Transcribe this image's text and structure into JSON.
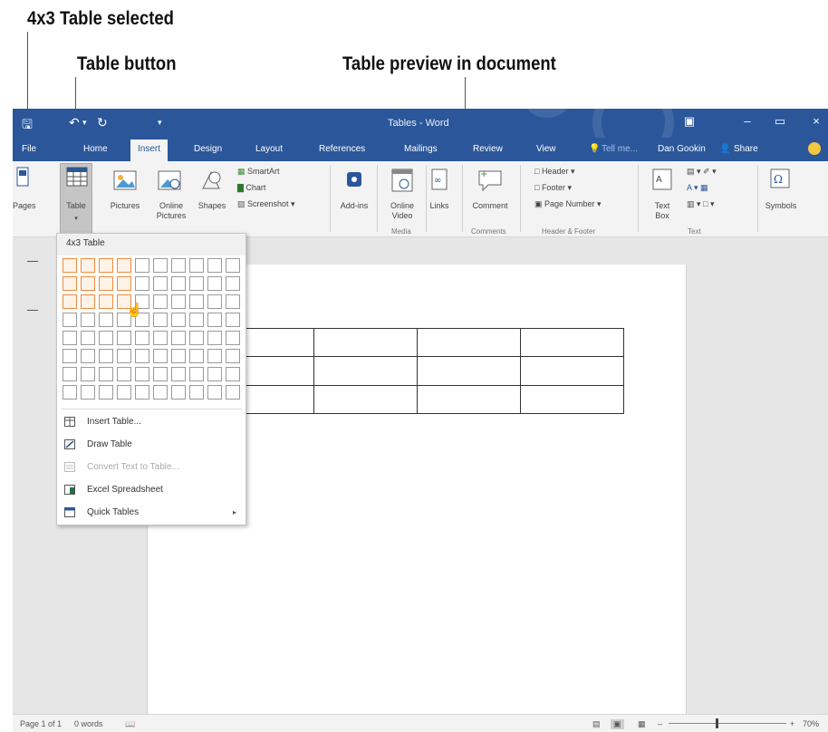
{
  "callouts": {
    "table_selected": "4x3 Table selected",
    "table_button": "Table button",
    "table_preview": "Table preview in document"
  },
  "title_bar": {
    "title": "Tables - Word",
    "minimize": "–",
    "maximize": "▭",
    "close": "×"
  },
  "tabs": [
    {
      "label": "File"
    },
    {
      "label": "Home"
    },
    {
      "label": "Insert"
    },
    {
      "label": "Design"
    },
    {
      "label": "Layout"
    },
    {
      "label": "References"
    },
    {
      "label": "Mailings"
    },
    {
      "label": "Review"
    },
    {
      "label": "View"
    }
  ],
  "tell_me": "Tell me...",
  "user_name": "Dan Gookin",
  "share_label": "Share",
  "ribbon": {
    "pages": "Pages",
    "table": "Table",
    "pictures": "Pictures",
    "online_pictures": "Online Pictures",
    "shapes": "Shapes",
    "smartart": "SmartArt",
    "chart": "Chart",
    "screenshot": "Screenshot",
    "addins": "Add-ins",
    "online_video": "Online Video",
    "links": "Links",
    "comment": "Comment",
    "header": "Header",
    "footer": "Footer",
    "page_number": "Page Number",
    "text_box": "Text Box",
    "symbols": "Symbols",
    "groups": {
      "media": "Media",
      "comments": "Comments",
      "header_footer": "Header & Footer",
      "text": "Text"
    }
  },
  "dropdown": {
    "header": "4x3 Table",
    "grid_columns": 10,
    "grid_rows": 8,
    "selected_columns": 4,
    "selected_rows": 3,
    "items": [
      {
        "label": "Insert Table...",
        "icon": "insert-table-icon",
        "enabled": true
      },
      {
        "label": "Draw Table",
        "icon": "draw-table-icon",
        "enabled": true
      },
      {
        "label": "Convert Text to Table...",
        "icon": "convert-text-icon",
        "enabled": false
      },
      {
        "label": "Excel Spreadsheet",
        "icon": "excel-icon",
        "enabled": true
      },
      {
        "label": "Quick Tables",
        "icon": "quick-tables-icon",
        "enabled": true,
        "submenu": true
      }
    ]
  },
  "preview_table": {
    "columns": 4,
    "rows": 3
  },
  "status_bar": {
    "page": "Page 1 of 1",
    "words": "0 words",
    "zoom": "70%"
  },
  "colors": {
    "accent": "#2b579a",
    "selected_cell": "#f08a3c"
  }
}
